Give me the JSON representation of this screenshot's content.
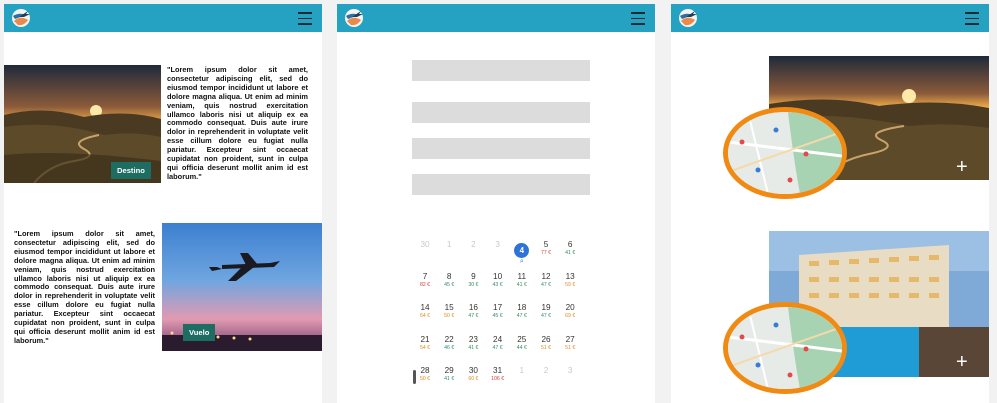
{
  "panel1": {
    "destino_label": "Destino",
    "vuelo_label": "Vuelo",
    "text_top": "\"Lorem ipsum dolor sit amet, consectetur adipiscing elit, sed do eiusmod tempor incididunt ut labore et dolore magna aliqua. Ut enim ad minim veniam, quis nostrud exercitation ullamco laboris nisi ut aliquip ex ea commodo consequat. Duis aute irure dolor in reprehenderit in voluptate velit esse cillum dolore eu fugiat nulla pariatur. Excepteur sint occaecat cupidatat non proident, sunt in culpa qui officia deserunt mollit anim id est laborum.\"",
    "text_bottom": "\"Lorem ipsum dolor sit amet, consectetur adipiscing elit, sed do eiusmod tempor incididunt ut labore et dolore magna aliqua. Ut enim ad minim veniam, quis nostrud exercitation ullamco laboris nisi ut aliquip ex ea commodo consequat. Duis aute irure dolor in reprehenderit in voluptate velit esse cillum dolore eu fugiat nulla pariatur. Excepteur sint occaecat cupidatat non proident, sunt in culpa qui officia deserunt mollit anim id est laborum.\""
  },
  "panel3": {
    "plus_1": "+",
    "plus_2": "+"
  },
  "calendar": {
    "rows": [
      [
        {
          "d": "30",
          "p": "",
          "c": "",
          "dim": true
        },
        {
          "d": "1",
          "p": "",
          "c": "",
          "dim": true
        },
        {
          "d": "2",
          "p": "",
          "c": "",
          "dim": true
        },
        {
          "d": "3",
          "p": "",
          "c": "",
          "dim": true
        },
        {
          "d": "4",
          "p": "",
          "c": "blue",
          "sel": true
        },
        {
          "d": "5",
          "p": "77 €",
          "c": "red"
        },
        {
          "d": "6",
          "p": "41 €",
          "c": "green"
        }
      ],
      [
        {
          "d": "7",
          "p": "82 €",
          "c": "red"
        },
        {
          "d": "8",
          "p": "45 €",
          "c": "green"
        },
        {
          "d": "9",
          "p": "30 €",
          "c": "green"
        },
        {
          "d": "10",
          "p": "43 €",
          "c": "green"
        },
        {
          "d": "11",
          "p": "41 €",
          "c": "green"
        },
        {
          "d": "12",
          "p": "47 €",
          "c": "green"
        },
        {
          "d": "13",
          "p": "59 €",
          "c": "orange"
        }
      ],
      [
        {
          "d": "14",
          "p": "64 €",
          "c": "orange"
        },
        {
          "d": "15",
          "p": "50 €",
          "c": "orange"
        },
        {
          "d": "16",
          "p": "47 €",
          "c": "green"
        },
        {
          "d": "17",
          "p": "45 €",
          "c": "green"
        },
        {
          "d": "18",
          "p": "47 €",
          "c": "green"
        },
        {
          "d": "19",
          "p": "47 €",
          "c": "green"
        },
        {
          "d": "20",
          "p": "69 €",
          "c": "orange"
        }
      ],
      [
        {
          "d": "21",
          "p": "54 €",
          "c": "orange"
        },
        {
          "d": "22",
          "p": "46 €",
          "c": "green"
        },
        {
          "d": "23",
          "p": "41 €",
          "c": "green"
        },
        {
          "d": "24",
          "p": "47 €",
          "c": "green"
        },
        {
          "d": "25",
          "p": "44 €",
          "c": "green"
        },
        {
          "d": "26",
          "p": "51 €",
          "c": "orange"
        },
        {
          "d": "27",
          "p": "51 €",
          "c": "orange"
        }
      ],
      [
        {
          "d": "28",
          "p": "50 €",
          "c": "orange"
        },
        {
          "d": "29",
          "p": "41 €",
          "c": "green"
        },
        {
          "d": "30",
          "p": "60 €",
          "c": "orange"
        },
        {
          "d": "31",
          "p": "106 €",
          "c": "red"
        },
        {
          "d": "1",
          "p": "",
          "c": "",
          "dim": true
        },
        {
          "d": "2",
          "p": "",
          "c": "",
          "dim": true
        },
        {
          "d": "3",
          "p": "",
          "c": "",
          "dim": true
        }
      ]
    ]
  },
  "colors": {
    "topbar": "#25a2c1",
    "tag": "#1e6d63",
    "selected_day": "#2f73d8",
    "map_ring": "#f08a12"
  },
  "icons": {
    "logo": "globe-plane-logo",
    "menu": "hamburger-menu-icon",
    "search": "search-icon",
    "add": "plus-icon"
  }
}
